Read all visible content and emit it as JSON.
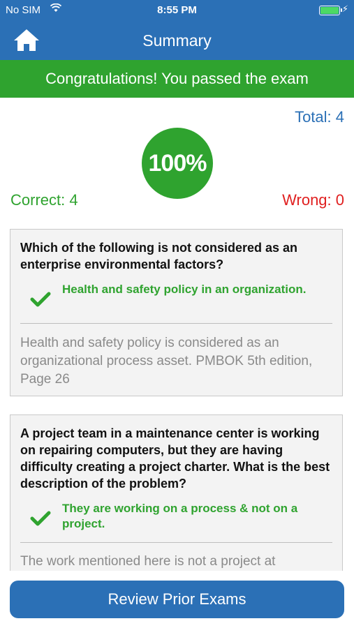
{
  "status_bar": {
    "carrier": "No SIM",
    "time": "8:55 PM",
    "battery_color": "#4cd964"
  },
  "nav": {
    "title": "Summary",
    "home_icon": "home-icon"
  },
  "banner": {
    "text": "Congratulations! You passed the exam",
    "color": "#2fa32f"
  },
  "score": {
    "total": "Total: 4",
    "percent": "100%",
    "correct": "Correct: 4",
    "wrong": "Wrong: 0"
  },
  "questions": [
    {
      "question": "Which of the following is not considered as an enterprise environmental factors?",
      "answer": "Health and safety policy in an organization.",
      "explanation": "Health and safety policy is considered as an organizational process asset. PMBOK 5th edition, Page 26"
    },
    {
      "question": "A project team in a maintenance center is working on repairing computers, but they are having difficulty creating a project charter. What is the best description of the problem?",
      "answer": "They are working on a process & not on a project.",
      "explanation": "The work mentioned here is not a project at"
    }
  ],
  "footer": {
    "review_label": "Review Prior Exams"
  },
  "colors": {
    "primary": "#2b70b6",
    "success": "#2fa32f",
    "error": "#e02020"
  }
}
